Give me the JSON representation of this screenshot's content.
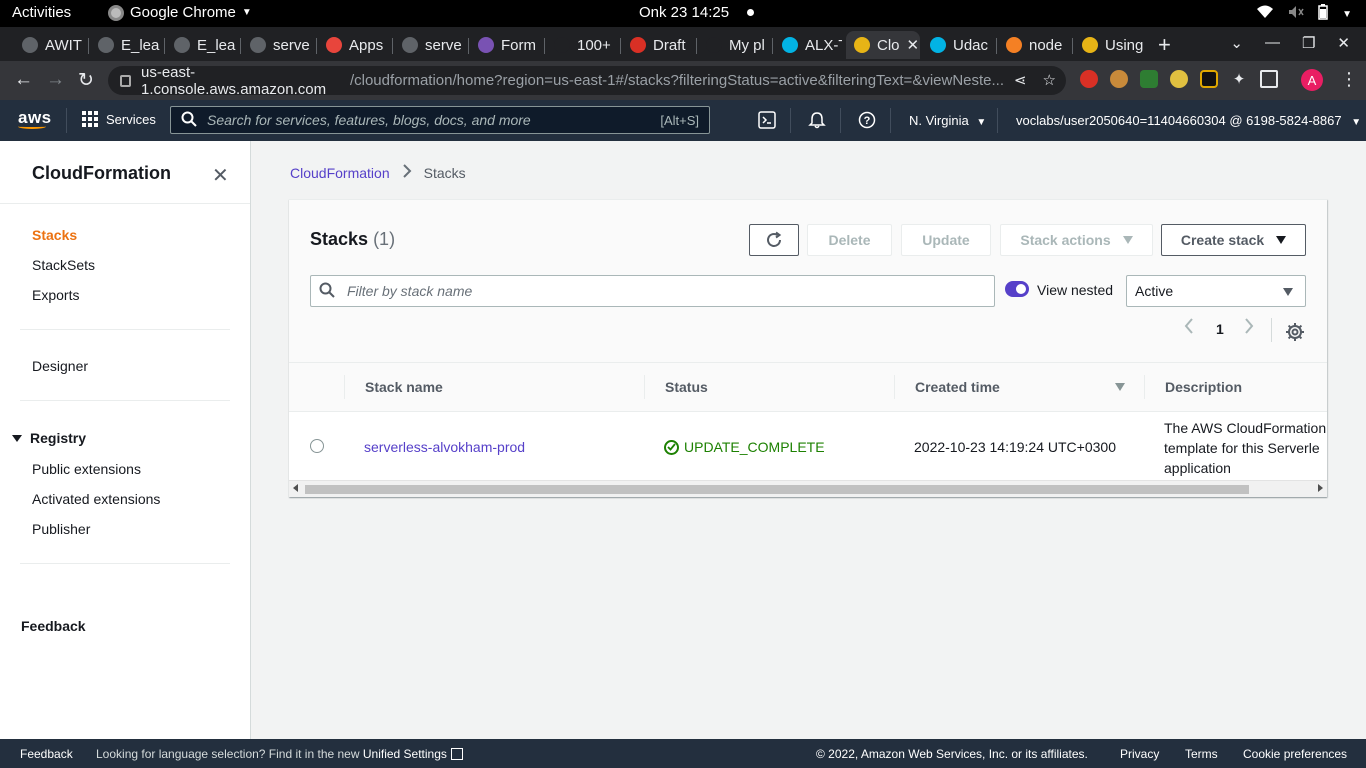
{
  "os_bar": {
    "activities": "Activities",
    "app_name": "Google Chrome",
    "clock": "Onk 23  14:25"
  },
  "tabs": [
    {
      "label": "AWIT",
      "favicon": "github-icon",
      "color": "#5f6368"
    },
    {
      "label": "E_lea",
      "favicon": "github-icon",
      "color": "#5f6368"
    },
    {
      "label": "E_lea",
      "favicon": "github-icon",
      "color": "#5f6368"
    },
    {
      "label": "serve",
      "favicon": "github-icon",
      "color": "#5f6368"
    },
    {
      "label": "Apps",
      "favicon": "apps-icon",
      "color": "#e8453c"
    },
    {
      "label": "serve",
      "favicon": "github-icon",
      "color": "#5f6368"
    },
    {
      "label": "Form",
      "favicon": "bootstrap-icon",
      "color": "#7952b3"
    },
    {
      "label": "100+",
      "favicon": "blank-icon",
      "color": "#202124"
    },
    {
      "label": "Draft",
      "favicon": "gmail-icon",
      "color": "#d93025"
    },
    {
      "label": "My pl",
      "favicon": "alx-icon",
      "color": "#202124"
    },
    {
      "label": "ALX-T",
      "favicon": "udacity-icon",
      "color": "#02b3e4"
    },
    {
      "label": "Clo",
      "favicon": "cloudformation-icon",
      "color": "#e7b416",
      "active": true
    },
    {
      "label": "Udac",
      "favicon": "udacity-icon",
      "color": "#02b3e4"
    },
    {
      "label": "node",
      "favicon": "stackoverflow-icon",
      "color": "#f48024"
    },
    {
      "label": "Using",
      "favicon": "cloudformation-icon",
      "color": "#e7b416"
    }
  ],
  "omnibox": {
    "host": "us-east-1.console.aws.amazon.com",
    "path": "/cloudformation/home?region=us-east-1#/stacks?filteringStatus=active&filteringText=&viewNeste..."
  },
  "profile": {
    "initial": "A",
    "color": "#e91e63"
  },
  "awsnav": {
    "logo": "aws",
    "services_label": "Services",
    "search_placeholder": "Search for services, features, blogs, docs, and more",
    "search_hint": "[Alt+S]",
    "region": "N. Virginia",
    "account": "voclabs/user2050640=11404660304 @ 6198-5824-8867"
  },
  "sidebar": {
    "title": "CloudFormation",
    "items": [
      "Stacks",
      "StackSets",
      "Exports"
    ],
    "designer": "Designer",
    "registry": {
      "label": "Registry",
      "items": [
        "Public extensions",
        "Activated extensions",
        "Publisher"
      ]
    },
    "feedback": "Feedback"
  },
  "breadcrumb": {
    "root": "CloudFormation",
    "current": "Stacks"
  },
  "stacks": {
    "title": "Stacks",
    "count": "(1)",
    "buttons": {
      "delete": "Delete",
      "update": "Update",
      "stack_actions": "Stack actions",
      "create_stack": "Create stack"
    },
    "filter_placeholder": "Filter by stack name",
    "view_nested_label": "View nested",
    "status_filter": "Active",
    "page": "1",
    "columns": {
      "name": "Stack name",
      "status": "Status",
      "created": "Created time",
      "description": "Description"
    },
    "rows": [
      {
        "name": "serverless-alvokham-prod",
        "status": "UPDATE_COMPLETE",
        "created": "2022-10-23 14:19:24 UTC+0300",
        "description_lines": [
          "The AWS CloudFormation",
          "template for this Serverle",
          "application"
        ]
      }
    ]
  },
  "footer": {
    "feedback": "Feedback",
    "lang_prefix": "Looking for language selection? Find it in the new",
    "lang_link": "Unified Settings",
    "copyright": "© 2022, Amazon Web Services, Inc. or its affiliates.",
    "privacy": "Privacy",
    "terms": "Terms",
    "cookies": "Cookie preferences"
  },
  "colors": {
    "aws_nav": "#232f3e",
    "aws_orange": "#ec7211",
    "link": "#5640c9",
    "success": "#1d8102"
  }
}
